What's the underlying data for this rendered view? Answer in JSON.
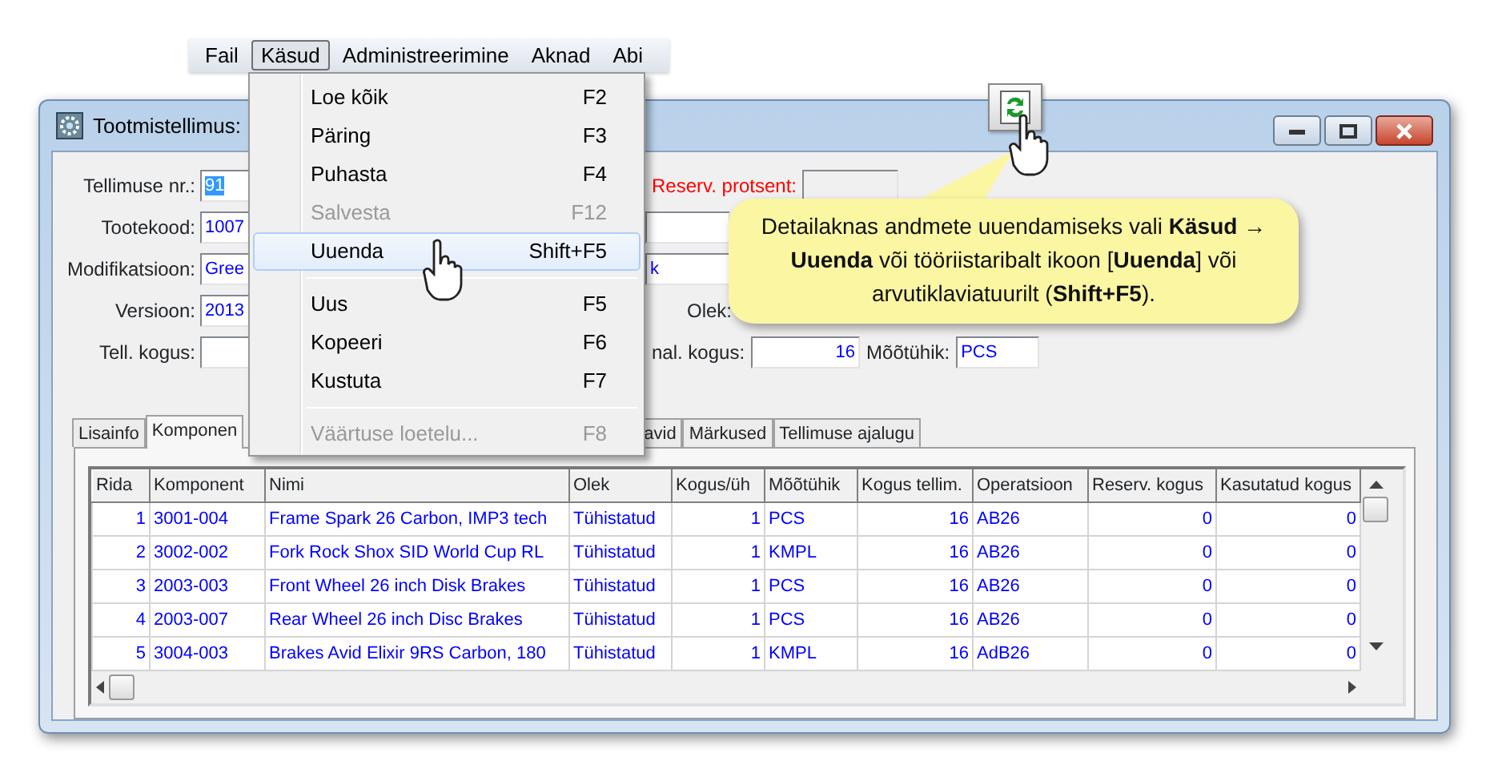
{
  "menu_bar": {
    "items": [
      {
        "label": "Fail",
        "selected": false
      },
      {
        "label": "Käsud",
        "selected": true
      },
      {
        "label": "Administreerimine",
        "selected": false
      },
      {
        "label": "Aknad",
        "selected": false
      },
      {
        "label": "Abi",
        "selected": false
      }
    ]
  },
  "dropdown_menu": {
    "items": [
      {
        "kind": "item",
        "label": "Loe kõik",
        "shortcut": "F2",
        "disabled": false,
        "selected": false
      },
      {
        "kind": "item",
        "label": "Päring",
        "shortcut": "F3",
        "disabled": false,
        "selected": false
      },
      {
        "kind": "item",
        "label": "Puhasta",
        "shortcut": "F4",
        "disabled": false,
        "selected": false
      },
      {
        "kind": "item",
        "label": "Salvesta",
        "shortcut": "F12",
        "disabled": true,
        "selected": false
      },
      {
        "kind": "item",
        "label": "Uuenda",
        "shortcut": "Shift+F5",
        "disabled": false,
        "selected": true
      },
      {
        "kind": "separator"
      },
      {
        "kind": "item",
        "label": "Uus",
        "shortcut": "F5",
        "disabled": false,
        "selected": false
      },
      {
        "kind": "item",
        "label": "Kopeeri",
        "shortcut": "F6",
        "disabled": false,
        "selected": false
      },
      {
        "kind": "item",
        "label": "Kustuta",
        "shortcut": "F7",
        "disabled": false,
        "selected": false
      },
      {
        "kind": "separator"
      },
      {
        "kind": "item",
        "label": "Väärtuse loetelu...",
        "shortcut": "F8",
        "disabled": true,
        "selected": false
      }
    ]
  },
  "window": {
    "title": "Tootmistellimus:",
    "form_rows": [
      {
        "left": {
          "label": "Tellimuse nr.:",
          "value": "91",
          "value_selected": true
        },
        "right": [
          {
            "kind": "label",
            "text": "Reserv. protsent:",
            "alert": true
          },
          {
            "kind": "field",
            "readonly": true
          }
        ]
      },
      {
        "left": {
          "label": "Tootekood:",
          "value": "1007",
          "value_selected": false
        },
        "right": [
          {
            "kind": "field",
            "readonly": false
          }
        ]
      },
      {
        "left": {
          "label": "Modifikatsioon:",
          "value": "Gree",
          "value_selected": false
        },
        "right": [
          {
            "kind": "field",
            "value": "k",
            "readonly": false
          }
        ]
      },
      {
        "left": {
          "label": "Versioon:",
          "value": "2013",
          "value_selected": false
        },
        "right": [
          {
            "kind": "label",
            "text": "Olek:",
            "alert": false
          }
        ]
      },
      {
        "left": {
          "label": "Tell. kogus:"
        },
        "right": [
          {
            "kind": "label",
            "text": "nal. kogus:",
            "alert": false
          },
          {
            "kind": "field",
            "value": "16",
            "numeric": true,
            "readonly": false
          },
          {
            "kind": "label",
            "text": "Mõõtühik:",
            "alert": false
          },
          {
            "kind": "field",
            "value": "PCS",
            "readonly": false
          }
        ]
      }
    ],
    "tabs": [
      {
        "label": "Lisainfo",
        "selected": false
      },
      {
        "label": "Komponen",
        "selected": true
      },
      {
        "label": "avid",
        "selected": false
      },
      {
        "label": "Märkused",
        "selected": false
      },
      {
        "label": "Tellimuse ajalugu",
        "selected": false
      }
    ],
    "table": {
      "columns": [
        {
          "label": "Rida",
          "numeric": true
        },
        {
          "label": "Komponent",
          "numeric": false
        },
        {
          "label": "Nimi",
          "numeric": false
        },
        {
          "label": "Olek",
          "numeric": false
        },
        {
          "label": "Kogus/üh",
          "numeric": true
        },
        {
          "label": "Mõõtühik",
          "numeric": false
        },
        {
          "label": "Kogus tellim.",
          "numeric": true
        },
        {
          "label": "Operatsioon",
          "numeric": false
        },
        {
          "label": "Reserv. kogus",
          "numeric": true
        },
        {
          "label": "Kasutatud kogus",
          "numeric": true
        }
      ],
      "rows": [
        [
          "1",
          "3001-004",
          "Frame Spark 26 Carbon, IMP3 tech",
          "Tühistatud",
          "1",
          "PCS",
          "16",
          "AB26",
          "0",
          "0"
        ],
        [
          "2",
          "3002-002",
          "Fork Rock Shox SID World Cup RL",
          "Tühistatud",
          "1",
          "KMPL",
          "16",
          "AB26",
          "0",
          "0"
        ],
        [
          "3",
          "2003-003",
          "Front Wheel 26 inch Disk Brakes",
          "Tühistatud",
          "1",
          "PCS",
          "16",
          "AB26",
          "0",
          "0"
        ],
        [
          "4",
          "2003-007",
          "Rear Wheel 26 inch Disc Brakes",
          "Tühistatud",
          "1",
          "PCS",
          "16",
          "AB26",
          "0",
          "0"
        ],
        [
          "5",
          "3004-003",
          "Brakes Avid Elixir 9RS Carbon, 180",
          "Tühistatud",
          "1",
          "KMPL",
          "16",
          "AdB26",
          "0",
          "0"
        ]
      ]
    }
  },
  "callout": {
    "text": "Detailaknas andmete uuendamiseks vali **Käsud → Uuenda** või tööriistaribalt ikoon [**Uuenda**] või arvutiklaviatuurilt (**Shift+F5**)."
  }
}
